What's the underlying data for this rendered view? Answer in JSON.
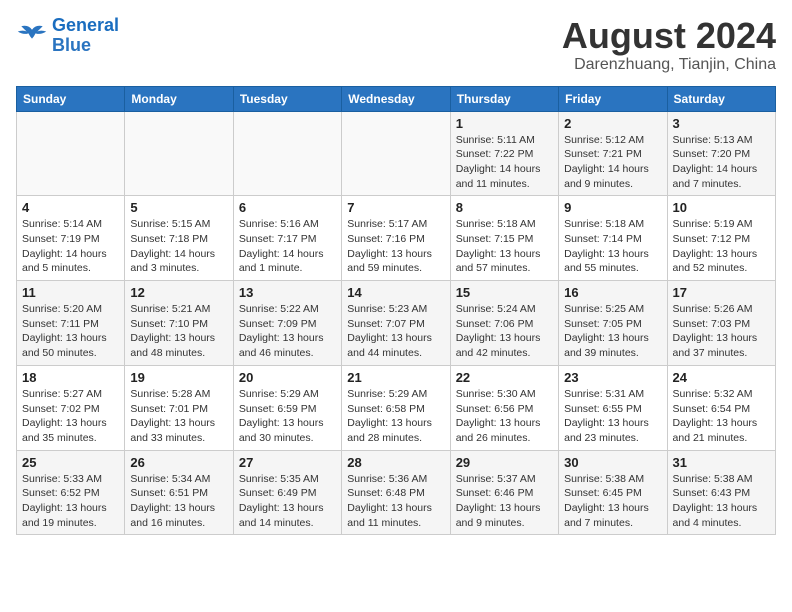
{
  "header": {
    "logo_line1": "General",
    "logo_line2": "Blue",
    "month_year": "August 2024",
    "location": "Darenzhuang, Tianjin, China"
  },
  "weekdays": [
    "Sunday",
    "Monday",
    "Tuesday",
    "Wednesday",
    "Thursday",
    "Friday",
    "Saturday"
  ],
  "weeks": [
    [
      {
        "day": "",
        "info": ""
      },
      {
        "day": "",
        "info": ""
      },
      {
        "day": "",
        "info": ""
      },
      {
        "day": "",
        "info": ""
      },
      {
        "day": "1",
        "info": "Sunrise: 5:11 AM\nSunset: 7:22 PM\nDaylight: 14 hours\nand 11 minutes."
      },
      {
        "day": "2",
        "info": "Sunrise: 5:12 AM\nSunset: 7:21 PM\nDaylight: 14 hours\nand 9 minutes."
      },
      {
        "day": "3",
        "info": "Sunrise: 5:13 AM\nSunset: 7:20 PM\nDaylight: 14 hours\nand 7 minutes."
      }
    ],
    [
      {
        "day": "4",
        "info": "Sunrise: 5:14 AM\nSunset: 7:19 PM\nDaylight: 14 hours\nand 5 minutes."
      },
      {
        "day": "5",
        "info": "Sunrise: 5:15 AM\nSunset: 7:18 PM\nDaylight: 14 hours\nand 3 minutes."
      },
      {
        "day": "6",
        "info": "Sunrise: 5:16 AM\nSunset: 7:17 PM\nDaylight: 14 hours\nand 1 minute."
      },
      {
        "day": "7",
        "info": "Sunrise: 5:17 AM\nSunset: 7:16 PM\nDaylight: 13 hours\nand 59 minutes."
      },
      {
        "day": "8",
        "info": "Sunrise: 5:18 AM\nSunset: 7:15 PM\nDaylight: 13 hours\nand 57 minutes."
      },
      {
        "day": "9",
        "info": "Sunrise: 5:18 AM\nSunset: 7:14 PM\nDaylight: 13 hours\nand 55 minutes."
      },
      {
        "day": "10",
        "info": "Sunrise: 5:19 AM\nSunset: 7:12 PM\nDaylight: 13 hours\nand 52 minutes."
      }
    ],
    [
      {
        "day": "11",
        "info": "Sunrise: 5:20 AM\nSunset: 7:11 PM\nDaylight: 13 hours\nand 50 minutes."
      },
      {
        "day": "12",
        "info": "Sunrise: 5:21 AM\nSunset: 7:10 PM\nDaylight: 13 hours\nand 48 minutes."
      },
      {
        "day": "13",
        "info": "Sunrise: 5:22 AM\nSunset: 7:09 PM\nDaylight: 13 hours\nand 46 minutes."
      },
      {
        "day": "14",
        "info": "Sunrise: 5:23 AM\nSunset: 7:07 PM\nDaylight: 13 hours\nand 44 minutes."
      },
      {
        "day": "15",
        "info": "Sunrise: 5:24 AM\nSunset: 7:06 PM\nDaylight: 13 hours\nand 42 minutes."
      },
      {
        "day": "16",
        "info": "Sunrise: 5:25 AM\nSunset: 7:05 PM\nDaylight: 13 hours\nand 39 minutes."
      },
      {
        "day": "17",
        "info": "Sunrise: 5:26 AM\nSunset: 7:03 PM\nDaylight: 13 hours\nand 37 minutes."
      }
    ],
    [
      {
        "day": "18",
        "info": "Sunrise: 5:27 AM\nSunset: 7:02 PM\nDaylight: 13 hours\nand 35 minutes."
      },
      {
        "day": "19",
        "info": "Sunrise: 5:28 AM\nSunset: 7:01 PM\nDaylight: 13 hours\nand 33 minutes."
      },
      {
        "day": "20",
        "info": "Sunrise: 5:29 AM\nSunset: 6:59 PM\nDaylight: 13 hours\nand 30 minutes."
      },
      {
        "day": "21",
        "info": "Sunrise: 5:29 AM\nSunset: 6:58 PM\nDaylight: 13 hours\nand 28 minutes."
      },
      {
        "day": "22",
        "info": "Sunrise: 5:30 AM\nSunset: 6:56 PM\nDaylight: 13 hours\nand 26 minutes."
      },
      {
        "day": "23",
        "info": "Sunrise: 5:31 AM\nSunset: 6:55 PM\nDaylight: 13 hours\nand 23 minutes."
      },
      {
        "day": "24",
        "info": "Sunrise: 5:32 AM\nSunset: 6:54 PM\nDaylight: 13 hours\nand 21 minutes."
      }
    ],
    [
      {
        "day": "25",
        "info": "Sunrise: 5:33 AM\nSunset: 6:52 PM\nDaylight: 13 hours\nand 19 minutes."
      },
      {
        "day": "26",
        "info": "Sunrise: 5:34 AM\nSunset: 6:51 PM\nDaylight: 13 hours\nand 16 minutes."
      },
      {
        "day": "27",
        "info": "Sunrise: 5:35 AM\nSunset: 6:49 PM\nDaylight: 13 hours\nand 14 minutes."
      },
      {
        "day": "28",
        "info": "Sunrise: 5:36 AM\nSunset: 6:48 PM\nDaylight: 13 hours\nand 11 minutes."
      },
      {
        "day": "29",
        "info": "Sunrise: 5:37 AM\nSunset: 6:46 PM\nDaylight: 13 hours\nand 9 minutes."
      },
      {
        "day": "30",
        "info": "Sunrise: 5:38 AM\nSunset: 6:45 PM\nDaylight: 13 hours\nand 7 minutes."
      },
      {
        "day": "31",
        "info": "Sunrise: 5:38 AM\nSunset: 6:43 PM\nDaylight: 13 hours\nand 4 minutes."
      }
    ]
  ]
}
